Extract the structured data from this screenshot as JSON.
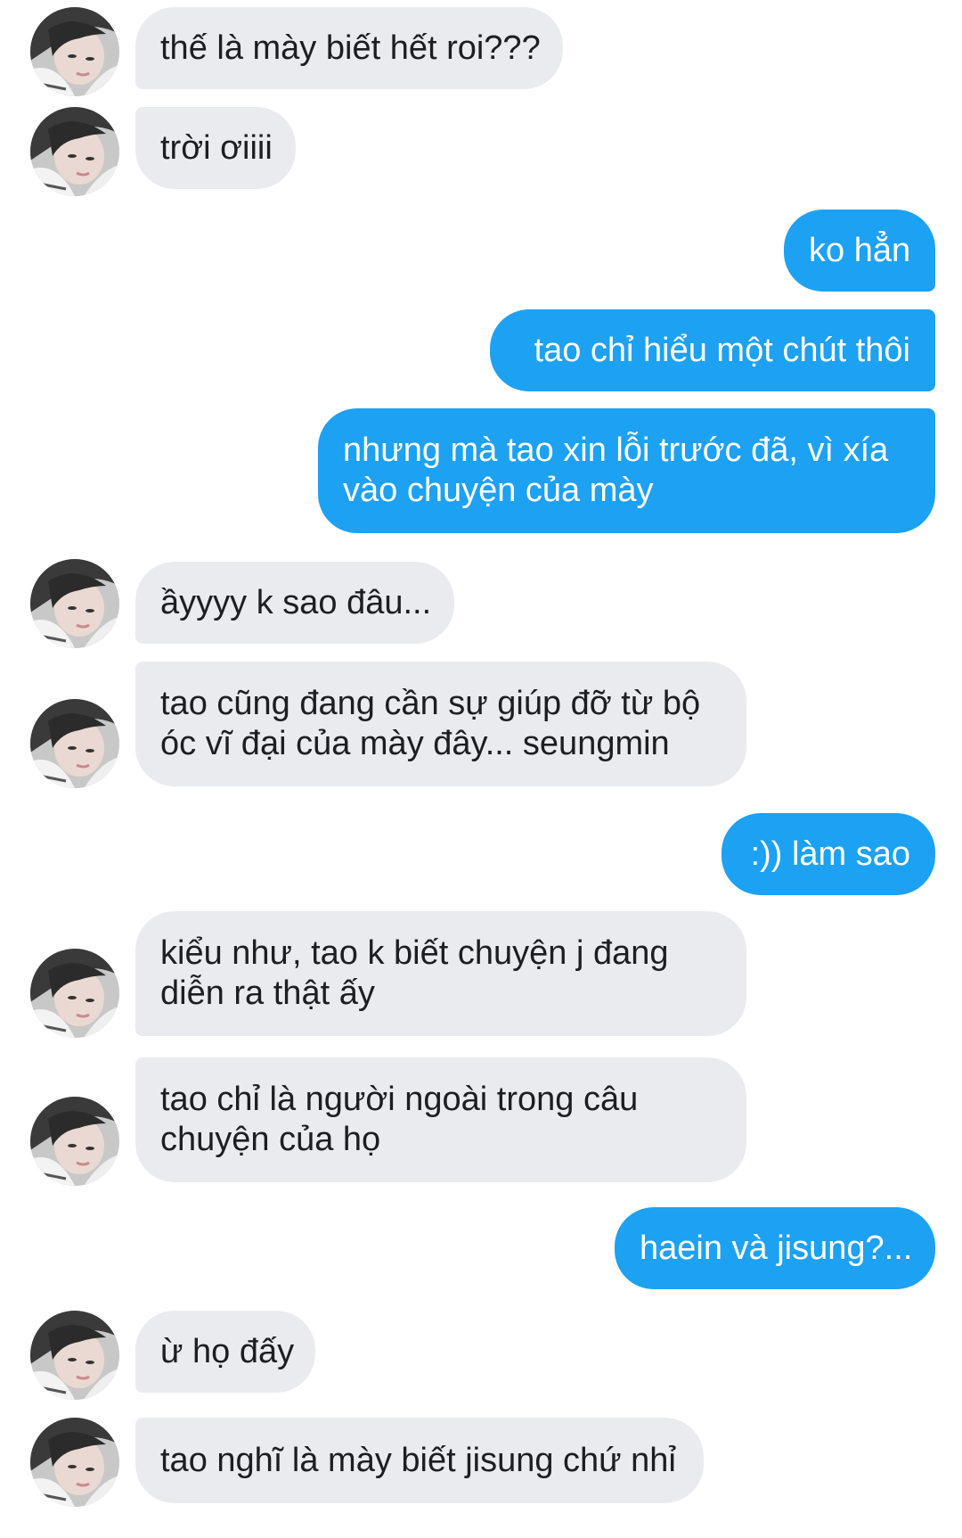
{
  "conversation": {
    "messages": [
      {
        "sender": "them",
        "text": "thế là mày biết hết roi???"
      },
      {
        "sender": "them",
        "text": "trời ơiiii"
      },
      {
        "sender": "me",
        "text": "ko hẳn"
      },
      {
        "sender": "me",
        "text": "tao chỉ hiểu một chút thôi"
      },
      {
        "sender": "me",
        "lines": [
          "nhưng mà tao xin lỗi trước đã, vì xía",
          "vào chuyện của mày"
        ]
      },
      {
        "sender": "them",
        "text": "ầyyyy k sao đâu..."
      },
      {
        "sender": "them",
        "lines": [
          "tao cũng đang cần sự giúp đỡ từ bộ",
          "óc vĩ đại của mày đây... seungmin"
        ]
      },
      {
        "sender": "me",
        "text": ":)) làm sao"
      },
      {
        "sender": "them",
        "lines": [
          "kiểu như, tao k biết chuyện j đang",
          "diễn ra thật ấy"
        ]
      },
      {
        "sender": "them",
        "lines": [
          "tao chỉ là người ngoài trong câu",
          "chuyện của họ"
        ]
      },
      {
        "sender": "me",
        "text": "haein và jisung?..."
      },
      {
        "sender": "them",
        "text": "ừ họ đấy"
      },
      {
        "sender": "them",
        "text": "tao nghĩ là mày biết jisung chứ nhỉ"
      }
    ]
  },
  "colors": {
    "incoming_bubble": "#e9ebee",
    "outgoing_bubble": "#1da1f2",
    "incoming_text": "#1c1e21",
    "outgoing_text": "#ffffff"
  },
  "icons": {
    "avatar": "contact-avatar-photo"
  }
}
